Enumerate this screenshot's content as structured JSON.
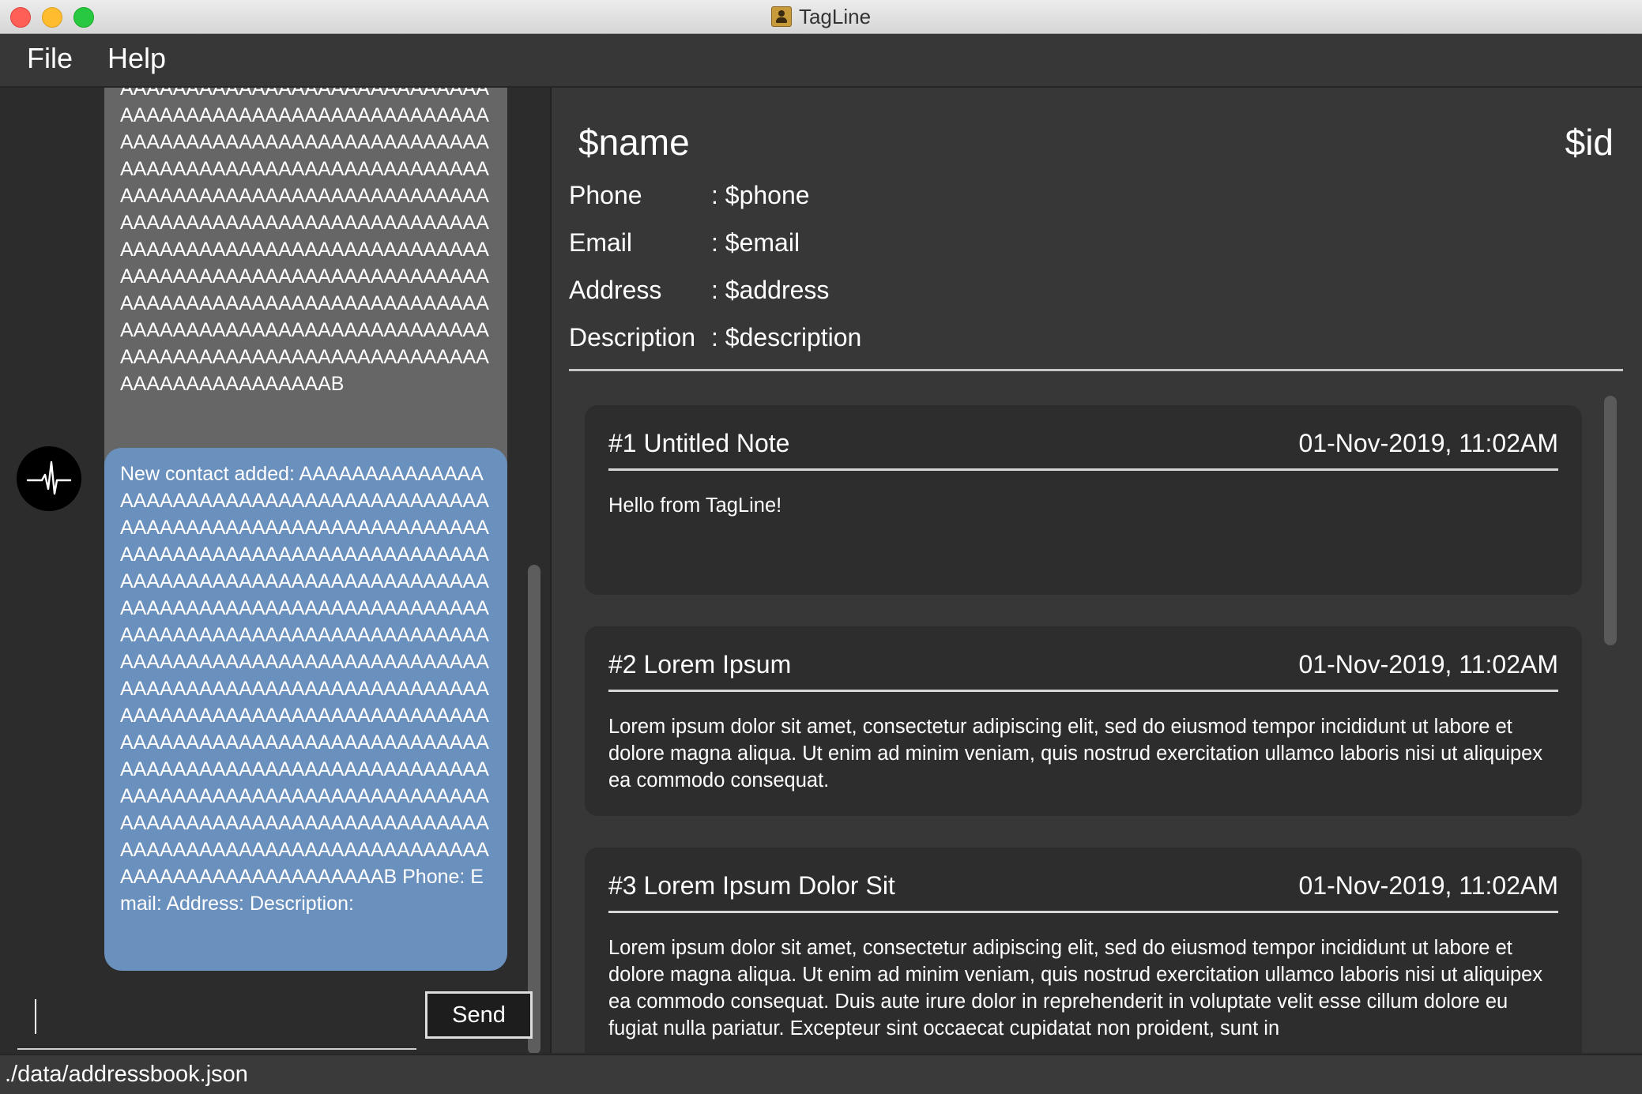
{
  "window": {
    "title": "TagLine"
  },
  "menu": {
    "items": [
      "File",
      "Help"
    ]
  },
  "chat": {
    "messages": [
      {
        "text": "AAAAAAAAAAAAAAAAAAAAAAAAAAAAAAAAAAAAAAAAAAAAAAAAAAAAAAAAAAAAAAAAAAAAAAAAAAAAAAAAAAAAAAAAAAAAAAAAAAAAAAAAAAAAAAAAAAAAAAAAAAAAAAAAAAAAAAAAAAAAAAAAAAAAAAAAAAAAAAAAAAAAAAAAAAAAAAAAAAAAAAAAAAAAAAAAAAAAAAAAAAAAAAAAAAAAAAAAAAAAAAAAAAAAAAAAAAAAAAAAAAAAAAAAAAAAAAAAAAAAAAAAAAAAAAAAAAAAAAAAAAAAAAAAAAAAAAAAAAAAAAAAAAAAAAAAAAAAAAAAAAAAB"
      },
      {
        "text": "New contact added: AAAAAAAAAAAAAAAAAAAAAAAAAAAAAAAAAAAAAAAAAAAAAAAAAAAAAAAAAAAAAAAAAAAAAAAAAAAAAAAAAAAAAAAAAAAAAAAAAAAAAAAAAAAAAAAAAAAAAAAAAAAAAAAAAAAAAAAAAAAAAAAAAAAAAAAAAAAAAAAAAAAAAAAAAAAAAAAAAAAAAAAAAAAAAAAAAAAAAAAAAAAAAAAAAAAAAAAAAAAAAAAAAAAAAAAAAAAAAAAAAAAAAAAAAAAAAAAAAAAAAAAAAAAAAAAAAAAAAAAAAAAAAAAAAAAAAAAAAAAAAAAAAAAAAAAAAAAAAAAAAAAAAAAAAAAAAAAAAAAAAAAAAAAAAAAAAAAAAAAAAAAAAAAAAAAAAAAAAAAAAAAAAAAAAAAAAAAAAAAAAAAAAAAAAAAAAAAAAAAAAAAAAAB Phone: Email: Address: Description:"
      }
    ],
    "input_value": "",
    "send_label": "Send"
  },
  "contact": {
    "name": "$name",
    "id": "$id",
    "fields": [
      {
        "label": "Phone",
        "value": ": $phone"
      },
      {
        "label": "Email",
        "value": ": $email"
      },
      {
        "label": "Address",
        "value": ": $address"
      },
      {
        "label": "Description",
        "value": ": $description"
      }
    ]
  },
  "notes": [
    {
      "title": "#1 Untitled Note",
      "date": "01-Nov-2019, 11:02AM",
      "body": "Hello from TagLine!"
    },
    {
      "title": "#2 Lorem Ipsum",
      "date": "01-Nov-2019, 11:02AM",
      "body": "Lorem ipsum dolor sit amet, consectetur adipiscing elit, sed do eiusmod tempor incididunt ut labore et dolore magna aliqua. Ut enim ad minim veniam, quis nostrud exercitation ullamco laboris nisi ut aliquipex ea commodo consequat."
    },
    {
      "title": "#3 Lorem Ipsum Dolor Sit",
      "date": "01-Nov-2019, 11:02AM",
      "body": "Lorem ipsum dolor sit amet, consectetur adipiscing elit, sed do eiusmod tempor incididunt ut labore et dolore magna aliqua. Ut enim ad minim veniam, quis nostrud exercitation ullamco laboris nisi ut aliquipex ea commodo consequat. Duis aute irure dolor in reprehenderit in voluptate velit esse cillum dolore eu fugiat nulla pariatur. Excepteur sint occaecat cupidatat non proident, sunt in"
    }
  ],
  "status": {
    "path": "./data/addressbook.json"
  },
  "colors": {
    "user_bubble": "#666666",
    "bot_bubble": "#6a90be",
    "pane_bg": "#373737"
  }
}
